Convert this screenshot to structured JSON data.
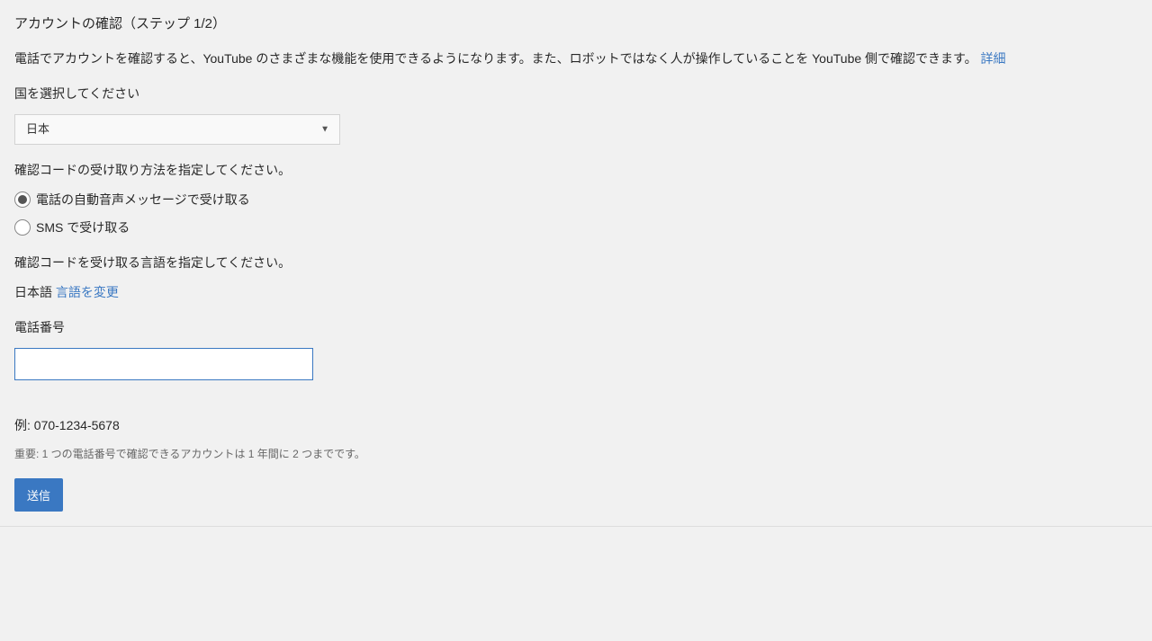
{
  "title": "アカウントの確認（ステップ 1/2）",
  "description": "電話でアカウントを確認すると、YouTube のさまざまな機能を使用できるようになります。また、ロボットではなく人が操作していることを YouTube 側で確認できます。 ",
  "details_link": "詳細",
  "country": {
    "label": "国を選択してください",
    "selected": "日本"
  },
  "code_method": {
    "label": "確認コードの受け取り方法を指定してください。",
    "options": [
      {
        "label": "電話の自動音声メッセージで受け取る",
        "selected": true
      },
      {
        "label": "SMS で受け取る",
        "selected": false
      }
    ]
  },
  "code_language": {
    "label": "確認コードを受け取る言語を指定してください。",
    "current": "日本語",
    "change_link": "言語を変更"
  },
  "phone": {
    "label": "電話番号",
    "value": "",
    "example": "例: 070-1234-5678"
  },
  "note": "重要: 1 つの電話番号で確認できるアカウントは 1 年間に 2 つまでです。",
  "submit_label": "送信"
}
